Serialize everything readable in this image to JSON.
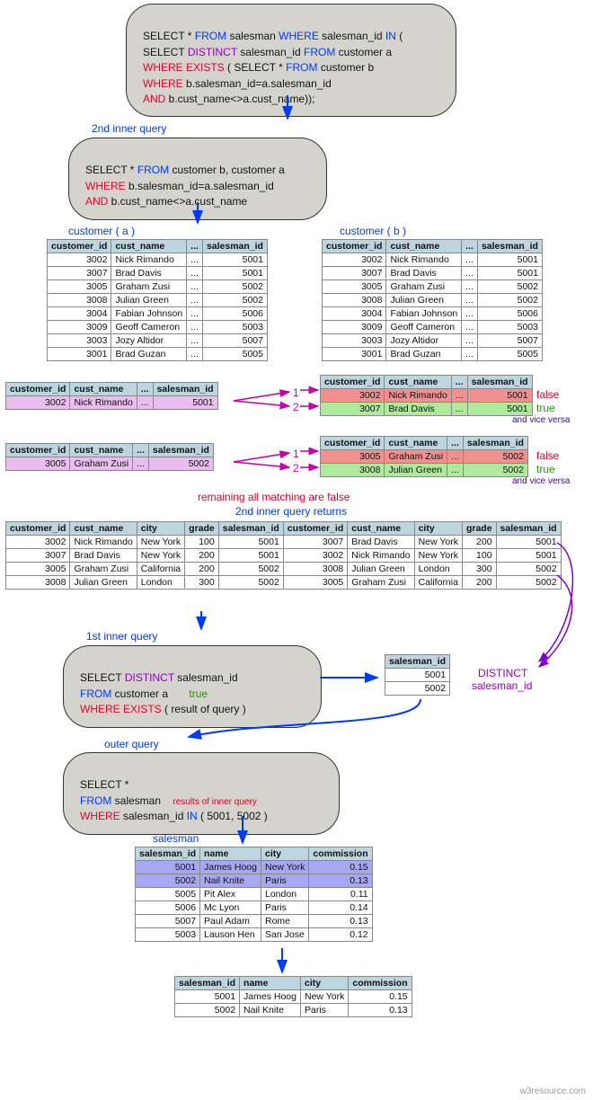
{
  "main_query": {
    "l1_a": "SELECT * ",
    "l1_b": "FROM",
    "l1_c": " salesman ",
    "l1_d": "WHERE",
    "l1_e": " salesman_id ",
    "l1_f": "IN",
    "l1_g": " (",
    "l2_a": "SELECT ",
    "l2_b": "DISTINCT",
    "l2_c": " salesman_id ",
    "l2_d": "FROM",
    "l2_e": " customer a",
    "l3_a": "WHERE EXISTS",
    "l3_b": " ( ",
    "l3_c": "SELECT * ",
    "l3_d": "FROM",
    "l3_e": " customer b",
    "l4_a": "WHERE",
    "l4_b": " b.salesman_id=a.salesman_id",
    "l5_a": "AND",
    "l5_b": " b.cust_name<>a.cust_name));"
  },
  "second_inner_query_label": "2nd inner query",
  "second_inner_query": {
    "l1_a": "SELECT * ",
    "l1_b": "FROM",
    "l1_c": " customer b, customer a",
    "l2_a": "WHERE",
    "l2_b": " b.salesman_id=a.salesman_id",
    "l3_a": "AND",
    "l3_b": " b.cust_name<>a.cust_name"
  },
  "table_labels": {
    "cust_a": "customer ( a )",
    "cust_b": "customer ( b )",
    "salesman": "salesman"
  },
  "cust_cols": [
    "customer_id",
    "cust_name",
    "...",
    "salesman_id"
  ],
  "cust_rows": [
    {
      "customer_id": "3002",
      "cust_name": "Nick Rimando",
      "dots": "...",
      "salesman_id": "5001"
    },
    {
      "customer_id": "3007",
      "cust_name": "Brad Davis",
      "dots": "...",
      "salesman_id": "5001"
    },
    {
      "customer_id": "3005",
      "cust_name": "Graham Zusi",
      "dots": "...",
      "salesman_id": "5002"
    },
    {
      "customer_id": "3008",
      "cust_name": "Julian Green",
      "dots": "...",
      "salesman_id": "5002"
    },
    {
      "customer_id": "3004",
      "cust_name": "Fabian Johnson",
      "dots": "...",
      "salesman_id": "5006"
    },
    {
      "customer_id": "3009",
      "cust_name": "Geoff Cameron",
      "dots": "...",
      "salesman_id": "5003"
    },
    {
      "customer_id": "3003",
      "cust_name": "Jozy Altidor",
      "dots": "...",
      "salesman_id": "5007"
    },
    {
      "customer_id": "3001",
      "cust_name": "Brad Guzan",
      "dots": "...",
      "salesman_id": "5005"
    }
  ],
  "match_a1": {
    "customer_id": "3002",
    "cust_name": "Nick Rimando",
    "dots": "...",
    "salesman_id": "5001"
  },
  "match_b1_rows": [
    {
      "customer_id": "3002",
      "cust_name": "Nick Rimando",
      "dots": "...",
      "salesman_id": "5001"
    },
    {
      "customer_id": "3007",
      "cust_name": "Brad Davis",
      "dots": "...",
      "salesman_id": "5001"
    }
  ],
  "match_b1_flags": [
    "false",
    "true"
  ],
  "vice_versa": "and vice versa",
  "match_a2": {
    "customer_id": "3005",
    "cust_name": "Graham Zusi",
    "dots": "...",
    "salesman_id": "5002"
  },
  "match_b2_rows": [
    {
      "customer_id": "3005",
      "cust_name": "Graham Zusi",
      "dots": "...",
      "salesman_id": "5002"
    },
    {
      "customer_id": "3008",
      "cust_name": "Julian Green",
      "dots": "...",
      "salesman_id": "5002"
    }
  ],
  "match_b2_flags": [
    "false",
    "true"
  ],
  "match_arrow_nums": [
    "1",
    "2"
  ],
  "remaining_label": "remaining all matching are false",
  "second_returns_label": "2nd inner query returns",
  "join_cols": [
    "customer_id",
    "cust_name",
    "city",
    "grade",
    "salesman_id",
    "customer_id",
    "cust_name",
    "city",
    "grade",
    "salesman_id"
  ],
  "join_rows": [
    [
      "3002",
      "Nick Rimando",
      "New York",
      "100",
      "5001",
      "3007",
      "Brad Davis",
      "New York",
      "200",
      "5001"
    ],
    [
      "3007",
      "Brad Davis",
      "New York",
      "200",
      "5001",
      "3002",
      "Nick Rimando",
      "New York",
      "100",
      "5001"
    ],
    [
      "3005",
      "Graham Zusi",
      "California",
      "200",
      "5002",
      "3008",
      "Julian Green",
      "London",
      "300",
      "5002"
    ],
    [
      "3008",
      "Julian Green",
      "London",
      "300",
      "5002",
      "3005",
      "Graham Zusi",
      "California",
      "200",
      "5002"
    ]
  ],
  "first_inner_query_label": "1st inner query",
  "first_inner_query": {
    "l1_a": "SELECT ",
    "l1_b": "DISTINCT",
    "l1_c": " salesman_id",
    "l2_a": "FROM",
    "l2_b": " customer a",
    "l2_true": "true",
    "l3_a": "WHERE EXISTS",
    "l3_b": " ( result of query )"
  },
  "distinct_label_1": "DISTINCT",
  "distinct_label_2": "salesman_id",
  "distinct_col": "salesman_id",
  "distinct_rows": [
    "5001",
    "5002"
  ],
  "outer_query_label": "outer query",
  "outer_query": {
    "l1": "SELECT *",
    "l2_a": "FROM",
    "l2_b": " salesman",
    "note": "results of inner query",
    "l3_a": "WHERE",
    "l3_b": " salesman_id ",
    "l3_c": "IN",
    "l3_d": " ( 5001, 5002 )"
  },
  "salesman_cols": [
    "salesman_id",
    "name",
    "city",
    "commission"
  ],
  "salesman_rows": [
    {
      "salesman_id": "5001",
      "name": "James Hoog",
      "city": "New York",
      "commission": "0.15"
    },
    {
      "salesman_id": "5002",
      "name": "Nail Knite",
      "city": "Paris",
      "commission": "0.13"
    },
    {
      "salesman_id": "5005",
      "name": "Pit Alex",
      "city": "London",
      "commission": "0.11"
    },
    {
      "salesman_id": "5006",
      "name": "Mc Lyon",
      "city": "Paris",
      "commission": "0.14"
    },
    {
      "salesman_id": "5007",
      "name": "Paul Adam",
      "city": "Rome",
      "commission": "0.13"
    },
    {
      "salesman_id": "5003",
      "name": "Lauson Hen",
      "city": "San Jose",
      "commission": "0.12"
    }
  ],
  "result_rows": [
    {
      "salesman_id": "5001",
      "name": "James Hoog",
      "city": "New York",
      "commission": "0.15"
    },
    {
      "salesman_id": "5002",
      "name": "Nail Knite",
      "city": "Paris",
      "commission": "0.13"
    }
  ],
  "watermark": "w3resource.com"
}
